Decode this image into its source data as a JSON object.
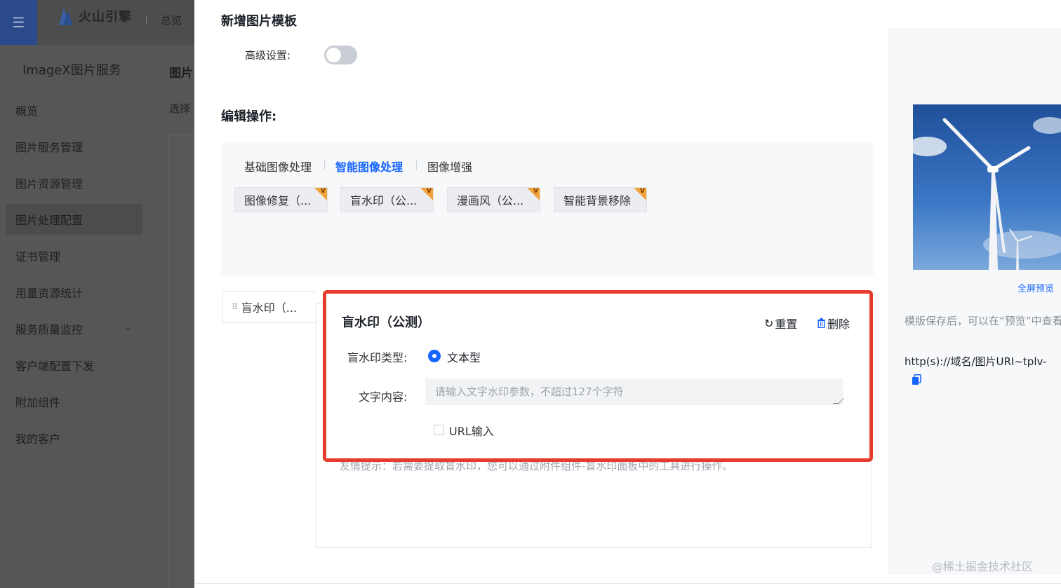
{
  "topbar": {
    "brand": "火山引擎",
    "overview": "总览"
  },
  "sidebar": {
    "product": "ImageX图片服务",
    "items": [
      {
        "label": "概览"
      },
      {
        "label": "图片服务管理"
      },
      {
        "label": "图片资源管理"
      },
      {
        "label": "图片处理配置"
      },
      {
        "label": "证书管理"
      },
      {
        "label": "用量资源统计"
      },
      {
        "label": "服务质量监控"
      },
      {
        "label": "客户端配置下发"
      },
      {
        "label": "附加组件"
      },
      {
        "label": "我的客户"
      }
    ]
  },
  "background": {
    "page_title": "图片",
    "select_text": "选择"
  },
  "drawer": {
    "title": "新增图片模板",
    "advanced_label": "高级设置:",
    "advanced_enabled": false,
    "edit_label": "编辑操作:",
    "tabs": [
      {
        "label": "基础图像处理",
        "active": false
      },
      {
        "label": "智能图像处理",
        "active": true
      },
      {
        "label": "图像增强",
        "active": false
      }
    ],
    "ops": [
      {
        "label": "图像修复（...",
        "badge": "V"
      },
      {
        "label": "盲水印（公...",
        "badge": "V"
      },
      {
        "label": "漫画风（公...",
        "badge": "V"
      },
      {
        "label": "智能背景移除",
        "badge": "V"
      }
    ],
    "step": {
      "label": "盲水印（..."
    },
    "config": {
      "title": "盲水印（公测）",
      "reset_label": "重置",
      "delete_label": "删除",
      "type_label": "盲水印类型:",
      "type_value": "文本型",
      "text_label": "文字内容:",
      "text_placeholder": "请输入文字水印参数，不超过127个字符",
      "url_input_label": "URL输入",
      "url_input_checked": false
    },
    "hint": "友情提示：若需要提取盲水印，您可以通过附件组件-盲水印面板中的工具进行操作。",
    "preview": {
      "fullscreen_label": "全屏预览",
      "description": "模版保存后，可以在“预览”中查看效果。",
      "url": "http(s)://域名/图片URI~tplv-"
    }
  },
  "watermark": "@稀土掘金技术社区",
  "colors": {
    "primary": "#1664ff",
    "highlight_border": "#e43d2d",
    "badge": "#f2a23a"
  }
}
